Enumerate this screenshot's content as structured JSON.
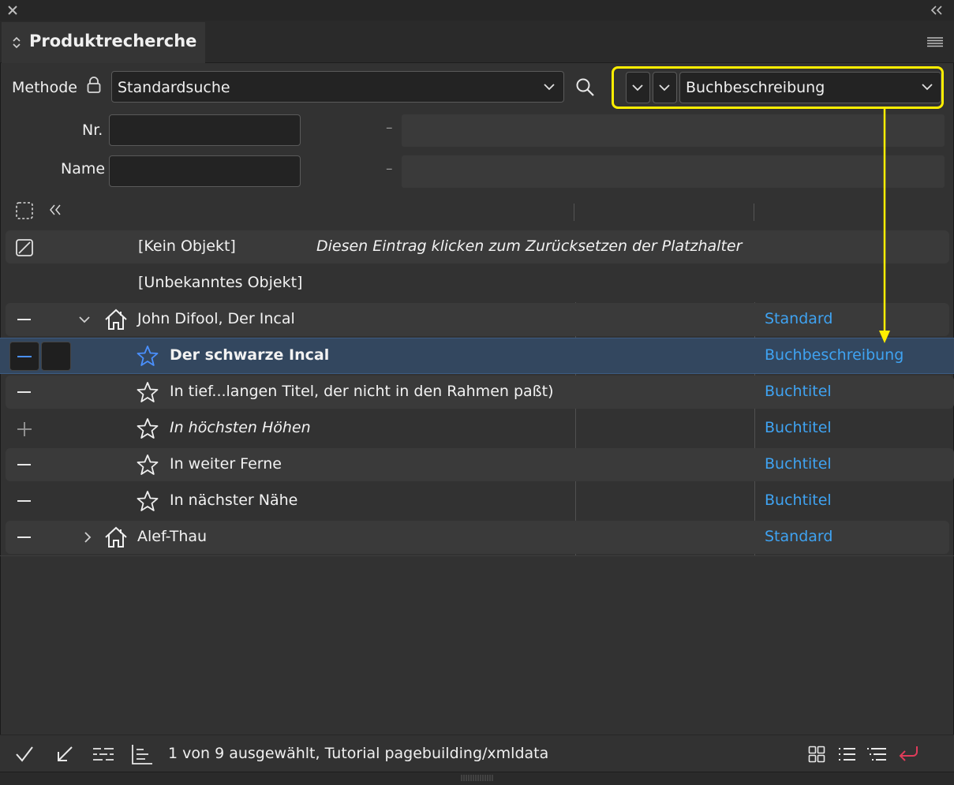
{
  "panel": {
    "title": "Produktrecherche",
    "colors": {
      "accent_blue": "#3fa3f2",
      "highlight": "#ffee00",
      "selected_row": "#33475f",
      "return_icon": "#e03c5a"
    }
  },
  "search": {
    "method_label": "Methode",
    "method_value": "Standardsuche",
    "template_value": "Buchbeschreibung",
    "nr_label": "Nr.",
    "nr_value": "",
    "nr_separator": "–",
    "name_label": "Name",
    "name_value": "",
    "name_separator": "–"
  },
  "list": {
    "special_rows": [
      {
        "label": "[Kein Objekt]",
        "hint": "Diesen Eintrag klicken zum Zurücksetzen der Platzhalter"
      },
      {
        "label": "[Unbekanntes Objekt]"
      }
    ],
    "rows": [
      {
        "title": "John Difool, Der Incal",
        "type": "Standard",
        "icon": "house-icon",
        "expanded": true
      },
      {
        "title": "Der schwarze Incal",
        "type": "Buchbeschreibung",
        "icon": "star-icon",
        "selected": true
      },
      {
        "title": "In tief...langen Titel, der nicht in den Rahmen paßt)",
        "type": "Buchtitel",
        "icon": "star-icon"
      },
      {
        "title": "In höchsten Höhen",
        "type": "Buchtitel",
        "icon": "star-icon",
        "italic": true
      },
      {
        "title": "In weiter Ferne",
        "type": "Buchtitel",
        "icon": "star-icon"
      },
      {
        "title": "In nächster Nähe",
        "type": "Buchtitel",
        "icon": "star-icon"
      },
      {
        "title": "Alef-Thau",
        "type": "Standard",
        "icon": "house-icon",
        "expanded": false
      }
    ]
  },
  "footer": {
    "status": "1 von 9 ausgewählt, Tutorial pagebuilding/xmldata"
  }
}
